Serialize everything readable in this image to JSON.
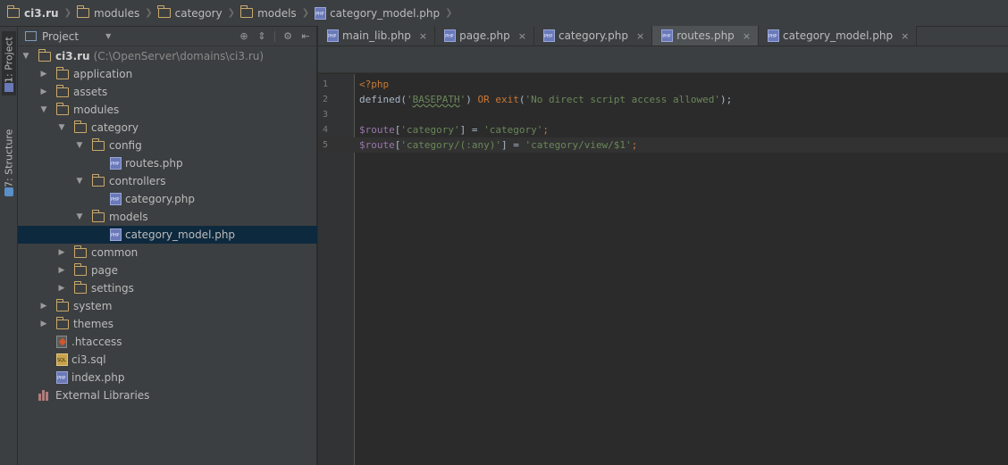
{
  "breadcrumb": [
    {
      "label": "ci3.ru",
      "icon": "folder-icon",
      "first": true
    },
    {
      "label": "modules",
      "icon": "folder-icon"
    },
    {
      "label": "category",
      "icon": "folder-icon"
    },
    {
      "label": "models",
      "icon": "folder-icon"
    },
    {
      "label": "category_model.php",
      "icon": "php-file-icon"
    }
  ],
  "toolstrip": {
    "project_tab": "1: Project",
    "structure_tab": "7: Structure"
  },
  "project_panel": {
    "title": "Project",
    "tools": [
      "locate-icon",
      "collapse-icon",
      "settings-icon",
      "hide-icon"
    ]
  },
  "tree": [
    {
      "label": "ci3.ru",
      "muted": "(C:\\OpenServer\\domains\\ci3.ru)",
      "type": "folder",
      "depth": 0,
      "arrow": "open",
      "root": true
    },
    {
      "label": "application",
      "type": "folder",
      "depth": 1,
      "arrow": "closed"
    },
    {
      "label": "assets",
      "type": "folder",
      "depth": 1,
      "arrow": "closed"
    },
    {
      "label": "modules",
      "type": "folder",
      "depth": 1,
      "arrow": "open"
    },
    {
      "label": "category",
      "type": "folder",
      "depth": 2,
      "arrow": "open"
    },
    {
      "label": "config",
      "type": "folder",
      "depth": 3,
      "arrow": "open"
    },
    {
      "label": "routes.php",
      "type": "php",
      "depth": 4,
      "arrow": "none"
    },
    {
      "label": "controllers",
      "type": "folder",
      "depth": 3,
      "arrow": "open"
    },
    {
      "label": "category.php",
      "type": "php",
      "depth": 4,
      "arrow": "none"
    },
    {
      "label": "models",
      "type": "folder",
      "depth": 3,
      "arrow": "open"
    },
    {
      "label": "category_model.php",
      "type": "php",
      "depth": 4,
      "arrow": "none",
      "selected": true
    },
    {
      "label": "common",
      "type": "folder",
      "depth": 2,
      "arrow": "closed"
    },
    {
      "label": "page",
      "type": "folder",
      "depth": 2,
      "arrow": "closed"
    },
    {
      "label": "settings",
      "type": "folder",
      "depth": 2,
      "arrow": "closed"
    },
    {
      "label": "system",
      "type": "folder",
      "depth": 1,
      "arrow": "closed"
    },
    {
      "label": "themes",
      "type": "folder",
      "depth": 1,
      "arrow": "closed"
    },
    {
      "label": ".htaccess",
      "type": "htaccess",
      "depth": 1,
      "arrow": "none"
    },
    {
      "label": "ci3.sql",
      "type": "sql",
      "depth": 1,
      "arrow": "none"
    },
    {
      "label": "index.php",
      "type": "php",
      "depth": 1,
      "arrow": "none"
    },
    {
      "label": "External Libraries",
      "type": "library",
      "depth": 0,
      "arrow": "none"
    }
  ],
  "tabs": [
    {
      "label": "main_lib.php",
      "active": false
    },
    {
      "label": "page.php",
      "active": false
    },
    {
      "label": "category.php",
      "active": false
    },
    {
      "label": "routes.php",
      "active": true
    },
    {
      "label": "category_model.php",
      "active": false
    }
  ],
  "tab_close_glyph": "×",
  "code_lines": [
    {
      "num": "1",
      "tokens": [
        {
          "t": "<?php",
          "c": "kw"
        }
      ]
    },
    {
      "num": "2",
      "tokens": [
        {
          "t": "defined(",
          "c": "plain"
        },
        {
          "t": "'",
          "c": "str"
        },
        {
          "t": "BASEPATH",
          "c": "str const-underline"
        },
        {
          "t": "'",
          "c": "str"
        },
        {
          "t": ") ",
          "c": "plain"
        },
        {
          "t": "OR ",
          "c": "kw"
        },
        {
          "t": "exit",
          "c": "kw"
        },
        {
          "t": "(",
          "c": "plain"
        },
        {
          "t": "'No direct script access allowed'",
          "c": "str"
        },
        {
          "t": ");",
          "c": "plain"
        }
      ]
    },
    {
      "num": "3",
      "tokens": []
    },
    {
      "num": "4",
      "tokens": [
        {
          "t": "$route",
          "c": "var"
        },
        {
          "t": "[",
          "c": "plain"
        },
        {
          "t": "'category'",
          "c": "str"
        },
        {
          "t": "] = ",
          "c": "plain"
        },
        {
          "t": "'category'",
          "c": "str"
        },
        {
          "t": ";",
          "c": "kw"
        }
      ]
    },
    {
      "num": "5",
      "current": true,
      "tokens": [
        {
          "t": "$route",
          "c": "var"
        },
        {
          "t": "[",
          "c": "plain"
        },
        {
          "t": "'category/(:any)'",
          "c": "str"
        },
        {
          "t": "] = ",
          "c": "plain"
        },
        {
          "t": "'category/view/$1'",
          "c": "str"
        },
        {
          "t": ";",
          "c": "kw"
        }
      ]
    }
  ],
  "colors": {
    "background": "#2b2b2b",
    "panel": "#3c3f41",
    "selection": "#0d293e",
    "keyword": "#cc7832",
    "string": "#6a8759",
    "variable": "#9876aa"
  }
}
